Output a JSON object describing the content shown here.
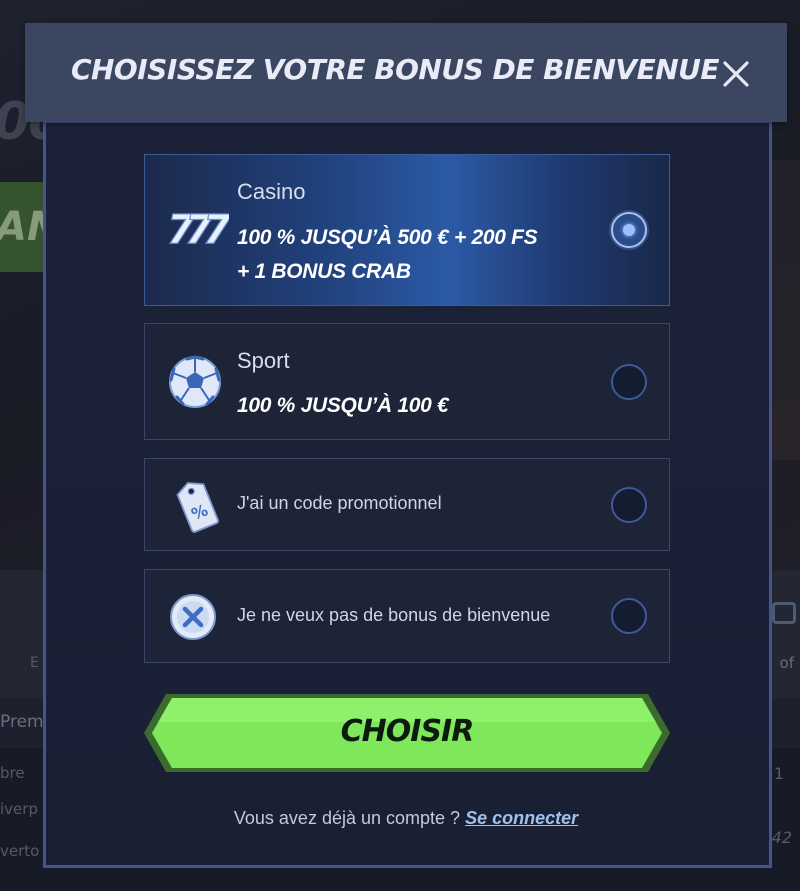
{
  "background": {
    "hero_text": "00",
    "hero_button": "AN",
    "strip_left": "E",
    "strip_right": "of",
    "table_header": "Prem",
    "row1": "bre",
    "row1_right": "1",
    "row2": "iverp",
    "row3": "verto",
    "row3_right": "42"
  },
  "modal": {
    "title": "CHOISISSEZ VOTRE BONUS DE BIENVENUE",
    "close_icon": "close-icon",
    "options": [
      {
        "id": "casino",
        "icon": "slot-777-icon",
        "title": "Casino",
        "value_line1": "100 % JUSQU’À 500 € + 200 FS",
        "value_line2": "+ 1 BONUS CRAB",
        "selected": true
      },
      {
        "id": "sport",
        "icon": "soccer-ball-icon",
        "title": "Sport",
        "value_line1": "100 % JUSQU’À 100 €",
        "selected": false
      },
      {
        "id": "promo",
        "icon": "promo-tag-icon",
        "text": "J'ai un code promotionnel",
        "selected": false
      },
      {
        "id": "none",
        "icon": "no-bonus-icon",
        "text": "Je ne veux pas de bonus de bienvenue",
        "selected": false
      }
    ],
    "cta_label": "CHOISIR",
    "footer_text": "Vous avez déjà un compte ?",
    "footer_link": "Se connecter"
  },
  "colors": {
    "accent_green": "#7ee85a",
    "selected_blue": "#2c5aa6",
    "header_bg": "#3b4661",
    "modal_border": "#46538d"
  }
}
